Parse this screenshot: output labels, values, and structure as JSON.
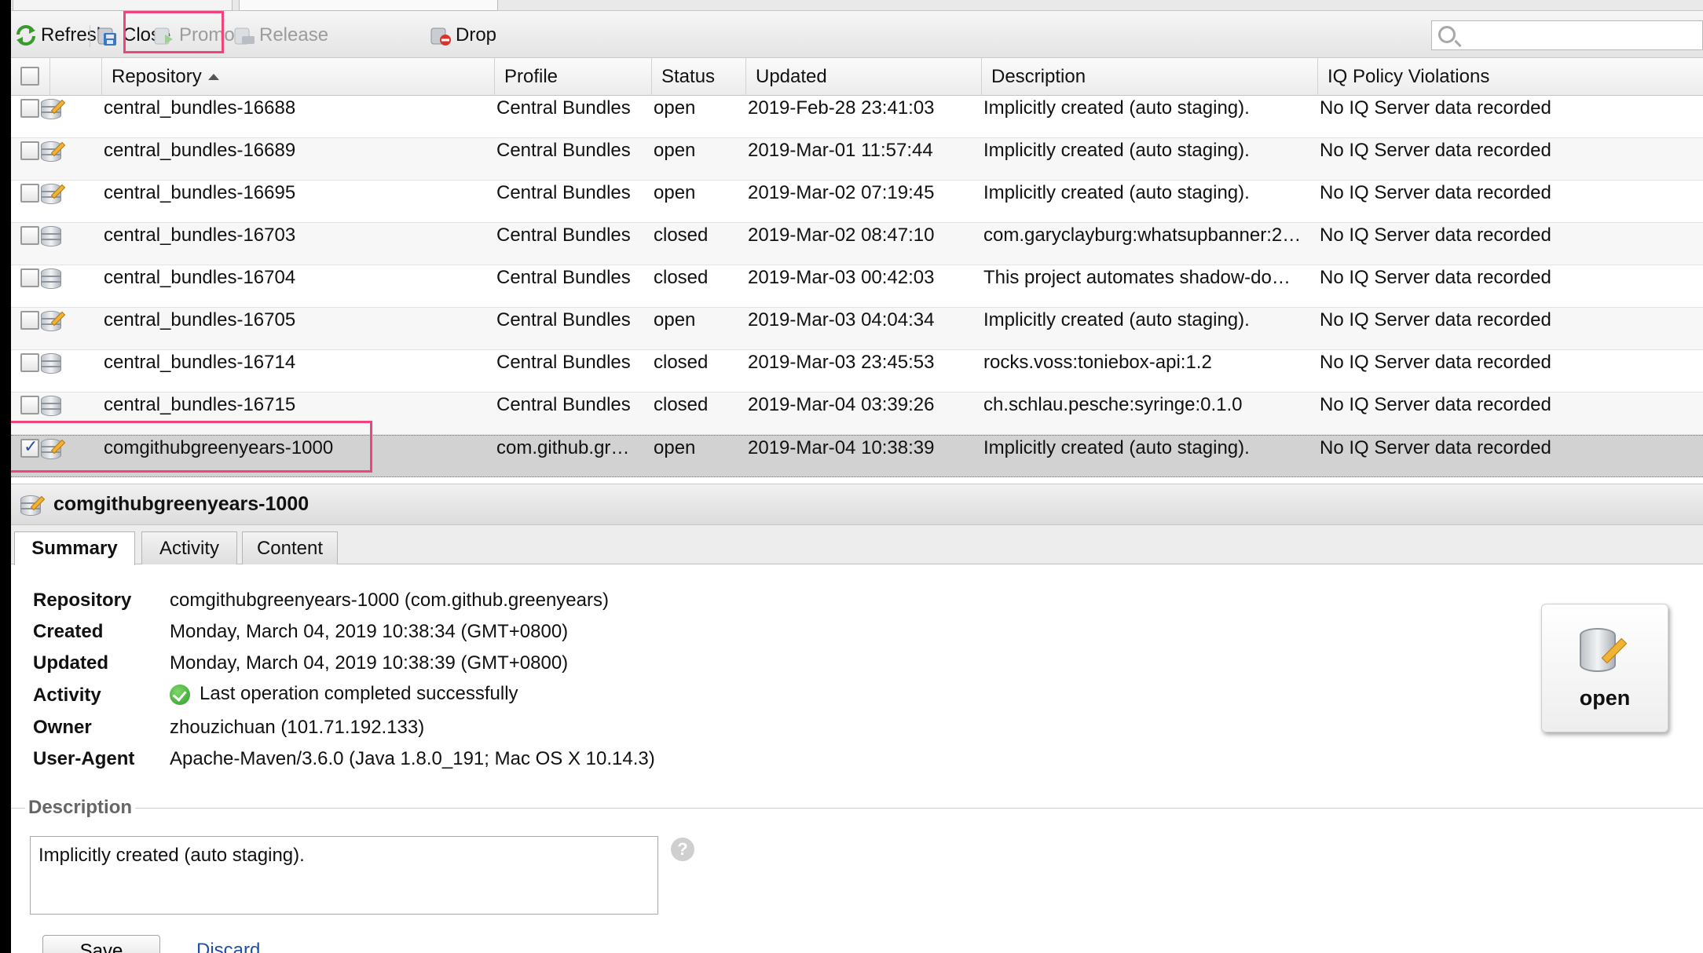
{
  "toolbar": {
    "refresh": "Refresh",
    "close": "Close",
    "promote": "Promote",
    "release": "Release",
    "drop": "Drop"
  },
  "search": {
    "placeholder": ""
  },
  "grid": {
    "headers": {
      "repository": "Repository",
      "profile": "Profile",
      "status": "Status",
      "updated": "Updated",
      "description": "Description",
      "iq": "IQ Policy Violations"
    },
    "rows": [
      {
        "repository": "central_bundles-16688",
        "profile": "Central Bundles",
        "status": "open",
        "updated": "2019-Feb-28 23:41:03",
        "description": "Implicitly created (auto staging).",
        "iq": "No IQ Server data recorded",
        "icon": "open-repo-icon",
        "checked": false
      },
      {
        "repository": "central_bundles-16689",
        "profile": "Central Bundles",
        "status": "open",
        "updated": "2019-Mar-01 11:57:44",
        "description": "Implicitly created (auto staging).",
        "iq": "No IQ Server data recorded",
        "icon": "open-repo-icon",
        "checked": false
      },
      {
        "repository": "central_bundles-16695",
        "profile": "Central Bundles",
        "status": "open",
        "updated": "2019-Mar-02 07:19:45",
        "description": "Implicitly created (auto staging).",
        "iq": "No IQ Server data recorded",
        "icon": "open-repo-icon",
        "checked": false
      },
      {
        "repository": "central_bundles-16703",
        "profile": "Central Bundles",
        "status": "closed",
        "updated": "2019-Mar-02 08:47:10",
        "description": "com.garyclayburg:whatsupbanner:2…",
        "iq": "No IQ Server data recorded",
        "icon": "closed-repo-icon",
        "checked": false
      },
      {
        "repository": "central_bundles-16704",
        "profile": "Central Bundles",
        "status": "closed",
        "updated": "2019-Mar-03 00:42:03",
        "description": "This project automates shadow-do…",
        "iq": "No IQ Server data recorded",
        "icon": "closed-repo-icon",
        "checked": false
      },
      {
        "repository": "central_bundles-16705",
        "profile": "Central Bundles",
        "status": "open",
        "updated": "2019-Mar-03 04:04:34",
        "description": "Implicitly created (auto staging).",
        "iq": "No IQ Server data recorded",
        "icon": "open-repo-icon",
        "checked": false
      },
      {
        "repository": "central_bundles-16714",
        "profile": "Central Bundles",
        "status": "closed",
        "updated": "2019-Mar-03 23:45:53",
        "description": "rocks.voss:toniebox-api:1.2",
        "iq": "No IQ Server data recorded",
        "icon": "closed-repo-icon",
        "checked": false
      },
      {
        "repository": "central_bundles-16715",
        "profile": "Central Bundles",
        "status": "closed",
        "updated": "2019-Mar-04 03:39:26",
        "description": "ch.schlau.pesche:syringe:0.1.0",
        "iq": "No IQ Server data recorded",
        "icon": "closed-repo-icon",
        "checked": false
      },
      {
        "repository": "comgithubgreenyears-1000",
        "profile": "com.github.gr…",
        "status": "open",
        "updated": "2019-Mar-04 10:38:39",
        "description": "Implicitly created (auto staging).",
        "iq": "No IQ Server data recorded",
        "icon": "open-repo-icon",
        "checked": true
      }
    ]
  },
  "detail": {
    "title": "comgithubgreenyears-1000",
    "tabs": [
      "Summary",
      "Activity",
      "Content"
    ],
    "summary": [
      {
        "label": "Repository",
        "value": "comgithubgreenyears-1000 (com.github.greenyears)"
      },
      {
        "label": "Created",
        "value": "Monday, March 04, 2019 10:38:34 (GMT+0800)"
      },
      {
        "label": "Updated",
        "value": "Monday, March 04, 2019 10:38:39 (GMT+0800)"
      },
      {
        "label": "Activity",
        "value": "Last operation completed successfully"
      },
      {
        "label": "Owner",
        "value": "zhouzichuan (101.71.192.133)"
      },
      {
        "label": "User-Agent",
        "value": "Apache-Maven/3.6.0 (Java 1.8.0_191; Mac OS X 10.14.3)"
      }
    ],
    "status_badge": "open",
    "description_section": "Description",
    "description_value": "Implicitly created (auto staging).",
    "help_symbol": "?",
    "save": "Save",
    "discard": "Discard"
  },
  "colors": {
    "highlight": "#f0457a",
    "selected_row": "#d2d2d2",
    "link": "#1f4ea5"
  }
}
